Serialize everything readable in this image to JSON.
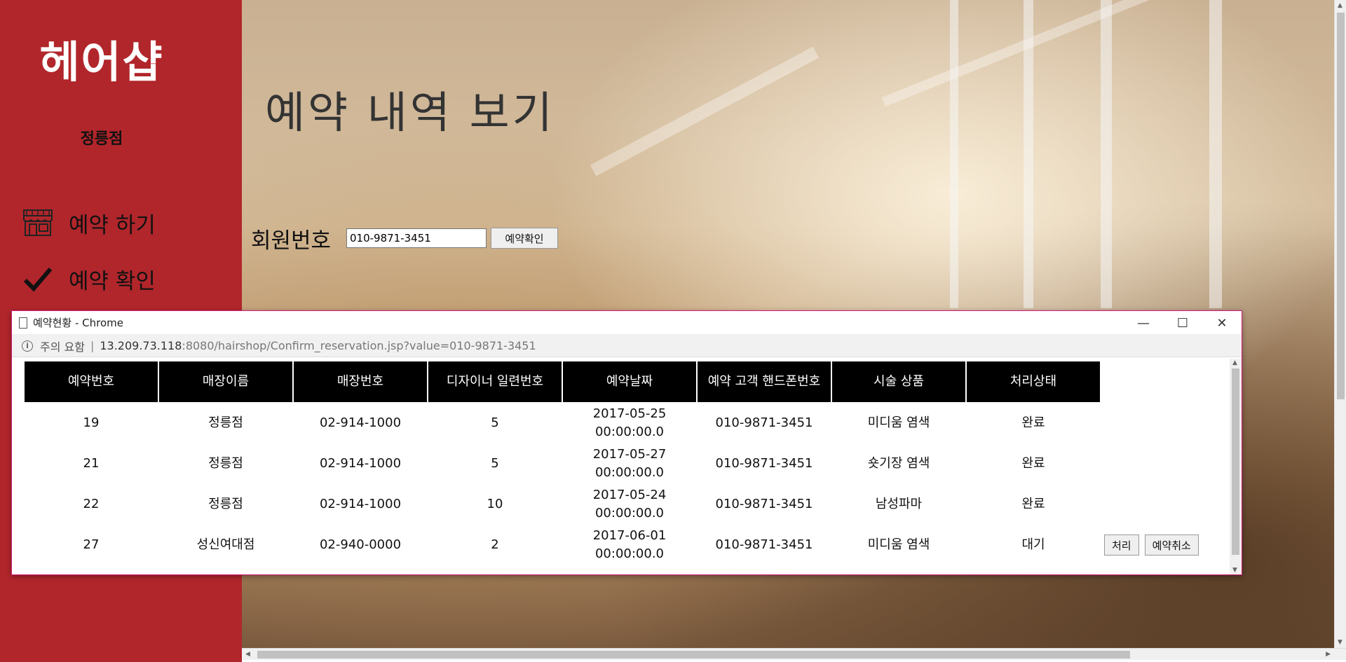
{
  "sidebar": {
    "brand": "헤어샵",
    "branch": "정릉점",
    "items": [
      {
        "label": "예약 하기",
        "icon": "storefront-icon"
      },
      {
        "label": "예약 확인",
        "icon": "checkmark-icon"
      }
    ]
  },
  "main": {
    "title": "예약 내역 보기",
    "member_label": "회원번호",
    "member_value": "010-9871-3451",
    "confirm_button": "예약확인"
  },
  "popup": {
    "window_title": "예약현황 - Chrome",
    "security_warning": "주의 요함",
    "url_host": "13.209.73.118",
    "url_rest": ":8080/hairshop/Confirm_reservation.jsp?value=010-9871-3451",
    "columns": [
      "예약번호",
      "매장이름",
      "매장번호",
      "디자이너 일련번호",
      "예약날짜",
      "예약 고객 핸드폰번호",
      "시술 상품",
      "처리상태"
    ],
    "rows": [
      {
        "id": "19",
        "store": "정릉점",
        "store_phone": "02-914-1000",
        "designer": "5",
        "date": "2017-05-25",
        "time": "00:00:00.0",
        "customer_phone": "010-9871-3451",
        "product": "미디움 염색",
        "status": "완료"
      },
      {
        "id": "21",
        "store": "정릉점",
        "store_phone": "02-914-1000",
        "designer": "5",
        "date": "2017-05-27",
        "time": "00:00:00.0",
        "customer_phone": "010-9871-3451",
        "product": "숏기장 염색",
        "status": "완료"
      },
      {
        "id": "22",
        "store": "정릉점",
        "store_phone": "02-914-1000",
        "designer": "10",
        "date": "2017-05-24",
        "time": "00:00:00.0",
        "customer_phone": "010-9871-3451",
        "product": "남성파마",
        "status": "완료"
      },
      {
        "id": "27",
        "store": "성신여대점",
        "store_phone": "02-940-0000",
        "designer": "2",
        "date": "2017-06-01",
        "time": "00:00:00.0",
        "customer_phone": "010-9871-3451",
        "product": "미디움 염색",
        "status": "대기",
        "actions": [
          "처리",
          "예약취소"
        ]
      }
    ]
  },
  "colors": {
    "sidebar_bg": "#b1262b",
    "header_bg": "#000000",
    "popup_border": "#d4187a"
  }
}
